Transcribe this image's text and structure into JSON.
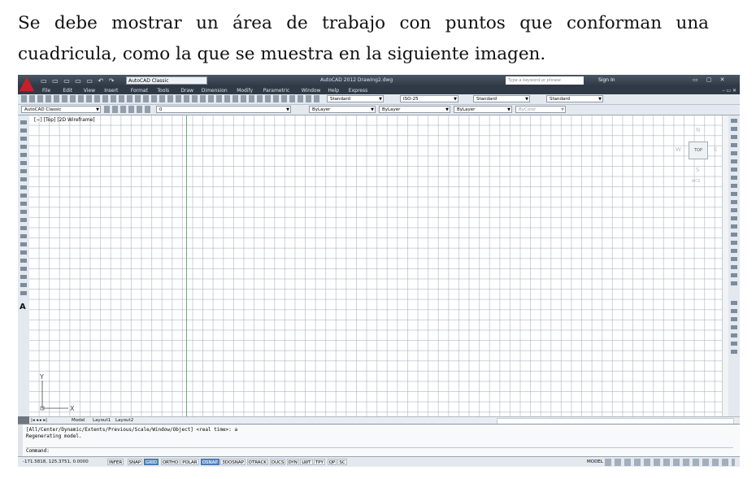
{
  "paragraph": {
    "line1": "Se debe mostrar un área de trabajo con puntos que conforman una",
    "line2": "cuadricula, como la que se muestra en la siguiente imagen."
  },
  "autocad": {
    "workspace": "AutoCAD Classic",
    "title": "AutoCAD 2012   Drawing2.dwg",
    "search_placeholder": "Type a keyword or phrase",
    "sign_in": "Sign In",
    "menu": [
      "File",
      "Edit",
      "View",
      "Insert",
      "Format",
      "Tools",
      "Draw",
      "Dimension",
      "Modify",
      "Parametric",
      "Window",
      "Help",
      "Express"
    ],
    "toolbar1": {
      "text_style": "Standard",
      "dim_style": "ISO-25",
      "table_style": "Standard",
      "mleader_style": "Standard"
    },
    "toolbar2": {
      "workspace": "AutoCAD Classic",
      "layer": "0",
      "color": "ByLayer",
      "linetype": "ByLayer",
      "lineweight": "ByLayer",
      "plotstyle": "ByColor"
    },
    "viewport_label": "[−] [Top] [2D Wireframe]",
    "viewcube": {
      "top": "TOP",
      "north": "N",
      "south": "S",
      "west": "W",
      "east": "E",
      "wcs": "WCS"
    },
    "ucs": {
      "x": "X",
      "y": "Y"
    },
    "tabs": [
      "Model",
      "Layout1",
      "Layout2"
    ],
    "command_history": [
      "[All/Center/Dynamic/Extents/Previous/Scale/Window/Object] <real time>: a",
      "Regenerating model."
    ],
    "command_prompt": "Command:",
    "coordinates": "-171.5818, 125.3751, 0.0000",
    "status_buttons": [
      "INFER",
      "SNAP",
      "GRID",
      "ORTHO",
      "POLAR",
      "OSNAP",
      "3DOSNAP",
      "OTRACK",
      "DUCS",
      "DYN",
      "LWT",
      "TPY",
      "QP",
      "SC"
    ],
    "status_active": [
      "GRID",
      "OSNAP"
    ],
    "model_label": "MODEL",
    "accent_color": "#5f8fc9"
  }
}
